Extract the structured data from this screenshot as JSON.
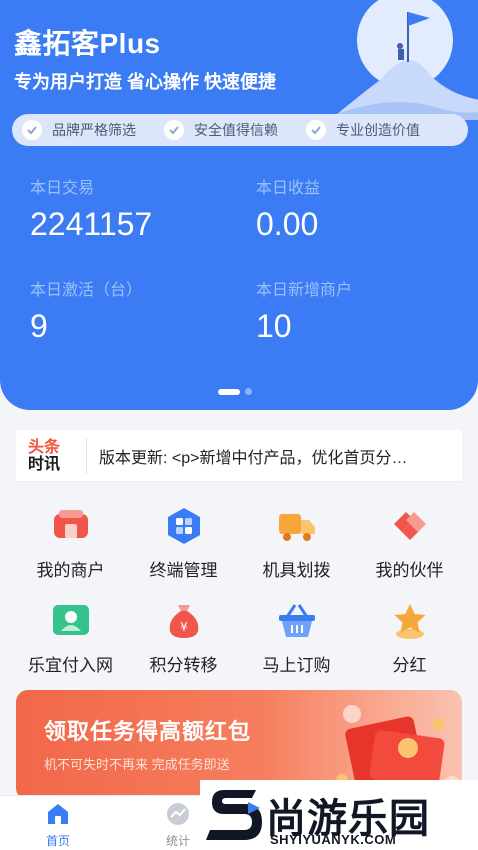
{
  "brand": {
    "title": "鑫拓客Plus",
    "slogan": "专为用户打造 省心操作 快速便捷"
  },
  "features": [
    {
      "label": "品牌严格筛选",
      "icon": "check-circle-icon"
    },
    {
      "label": "安全值得信赖",
      "icon": "check-circle-icon"
    },
    {
      "label": "专业创造价值",
      "icon": "check-circle-icon"
    }
  ],
  "stats": [
    {
      "label": "本日交易",
      "value": "2241157"
    },
    {
      "label": "本日收益",
      "value": "0.00"
    },
    {
      "label": "本日激活（台）",
      "value": "9"
    },
    {
      "label": "本日新增商户",
      "value": "10"
    }
  ],
  "carousel": {
    "current": 1,
    "total": 2
  },
  "news": {
    "badge_line1": "头条",
    "badge_line2": "时讯",
    "text": "版本更新: <p>新增中付产品，优化首页分…"
  },
  "menu": [
    {
      "label": "我的商户",
      "icon": "merchant-icon",
      "color": "#f0564b"
    },
    {
      "label": "终端管理",
      "icon": "terminal-grid-icon",
      "color": "#3b7bf3"
    },
    {
      "label": "机具划拨",
      "icon": "truck-icon",
      "color": "#f7a63a"
    },
    {
      "label": "我的伙伴",
      "icon": "handshake-icon",
      "color": "#f0564b"
    },
    {
      "label": "乐宜付入网",
      "icon": "user-card-icon",
      "color": "#36c28c"
    },
    {
      "label": "积分转移",
      "icon": "money-bag-icon",
      "color": "#f0564b"
    },
    {
      "label": "马上订购",
      "icon": "basket-icon",
      "color": "#3b7bf3"
    },
    {
      "label": "分红",
      "icon": "star-icon",
      "color": "#f7a63a"
    }
  ],
  "banner": {
    "title": "领取任务得高额红包",
    "subtitle": "机不可失时不再来 完成任务即送"
  },
  "tabs": [
    {
      "label": "首页",
      "icon": "home-icon",
      "active": true
    },
    {
      "label": "统计",
      "icon": "stats-icon",
      "active": false
    }
  ],
  "watermark": {
    "text": "尚游乐园",
    "url": "SHYIYUANYK.COM"
  },
  "colors": {
    "primary": "#3b7bf3",
    "accent_red": "#f0564b",
    "accent_orange": "#f7a63a",
    "accent_green": "#36c28c"
  }
}
